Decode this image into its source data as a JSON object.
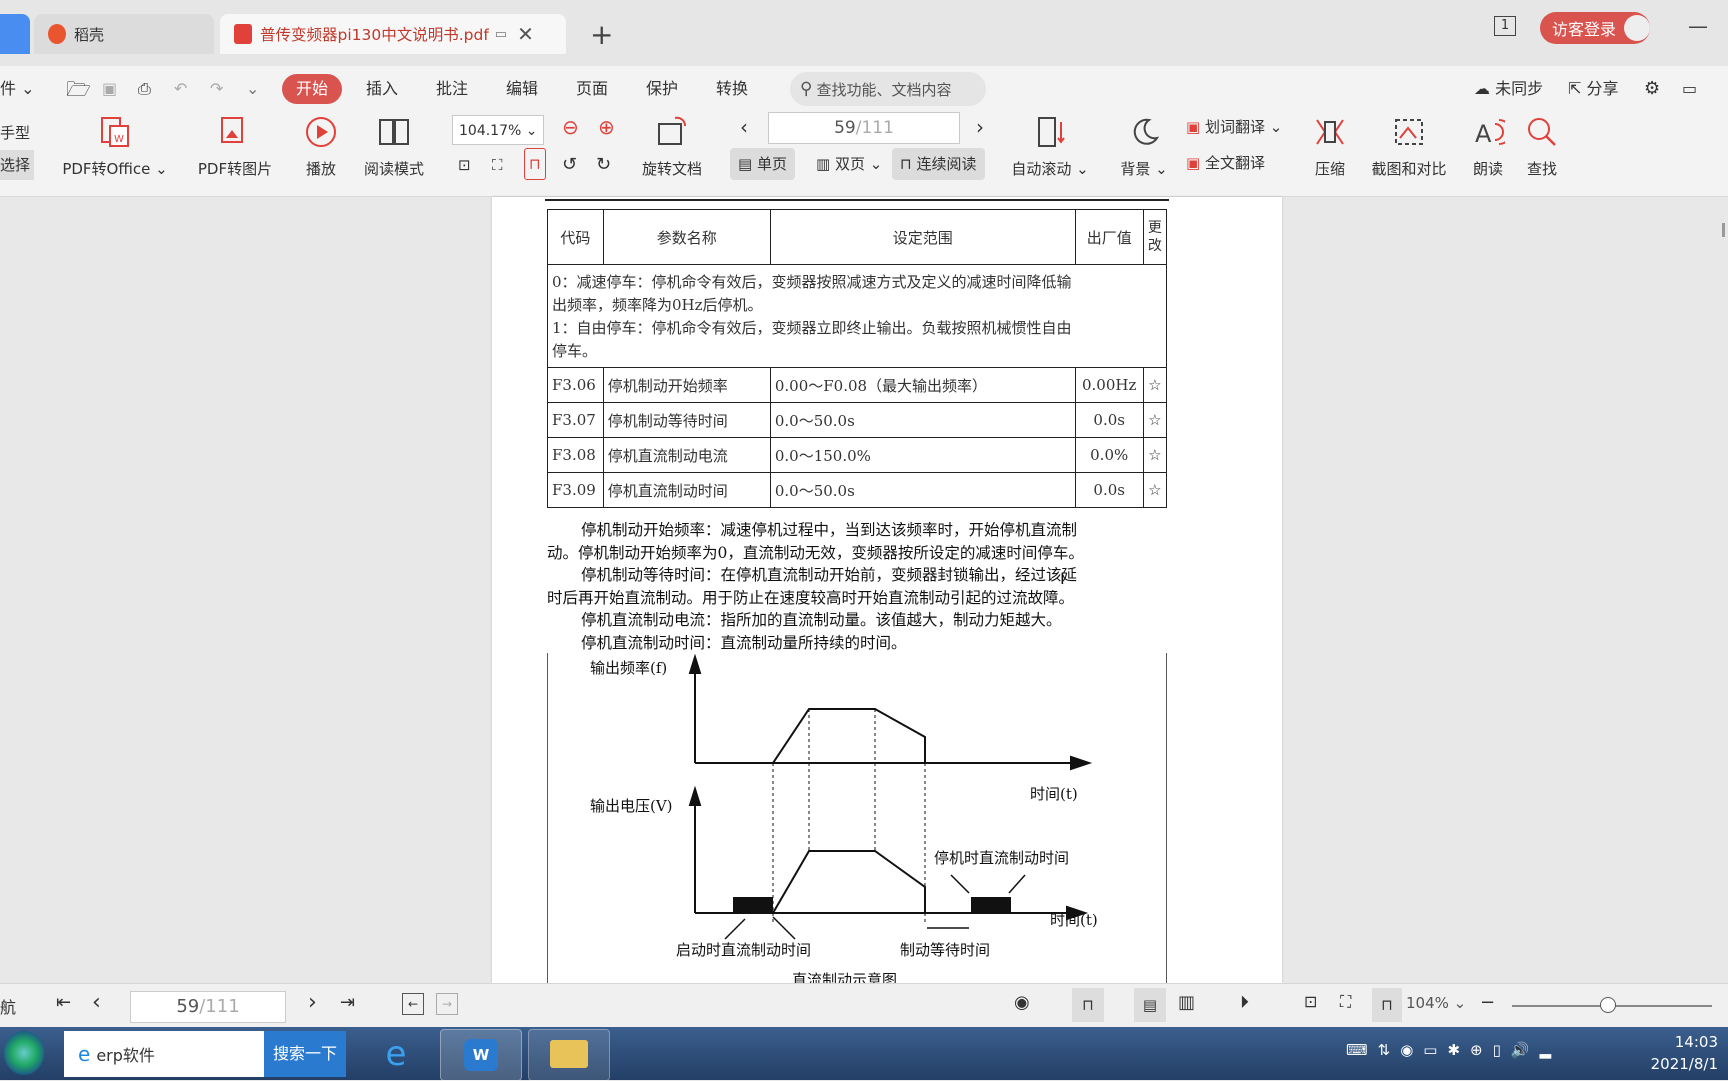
{
  "tabs": {
    "home": "稻壳",
    "doc": "普传变频器pi130中文说明书.pdf"
  },
  "titlebar": {
    "page_indicator": "1",
    "login": "访客登录"
  },
  "menu": {
    "file": "件",
    "items": [
      "开始",
      "插入",
      "批注",
      "编辑",
      "页面",
      "保护",
      "转换"
    ],
    "search_placeholder": "查找功能、文档内容",
    "sync": "未同步",
    "share": "分享"
  },
  "toolbar": {
    "left_cut1": "手型",
    "left_cut2": "选择",
    "pdf_to_office": "PDF转Office",
    "pdf_to_image": "PDF转图片",
    "play": "播放",
    "read_mode": "阅读模式",
    "zoom": "104.17%",
    "rotate": "旋转文档",
    "page_current": "59",
    "page_total": "/111",
    "single": "单页",
    "double": "双页",
    "continuous": "连续阅读",
    "auto_scroll": "自动滚动",
    "background": "背景",
    "word_translate": "划词翻译",
    "full_translate": "全文翻译",
    "compress": "压缩",
    "screenshot_compare": "截图和对比",
    "read_aloud": "朗读",
    "find": "查找"
  },
  "document": {
    "table_headers": [
      "代码",
      "参数名称",
      "设定范围",
      "出厂值",
      "更改"
    ],
    "intro_lines": [
      "0：减速停车：停机命令有效后，变频器按照减速方式及定义的减速时间降低输",
      "出频率，频率降为0Hz后停机。",
      "1：自由停车：停机命令有效后，变频器立即终止输出。负载按照机械惯性自由",
      "停车。"
    ],
    "rows": [
      {
        "code": "F3.06",
        "name": "停机制动开始频率",
        "range": "0.00～F0.08（最大输出频率）",
        "default": "0.00Hz",
        "change": "☆"
      },
      {
        "code": "F3.07",
        "name": "停机制动等待时间",
        "range": "0.0～50.0s",
        "default": "0.0s",
        "change": "☆"
      },
      {
        "code": "F3.08",
        "name": "停机直流制动电流",
        "range": "0.0～150.0%",
        "default": "0.0%",
        "change": "☆"
      },
      {
        "code": "F3.09",
        "name": "停机直流制动时间",
        "range": "0.0～50.0s",
        "default": "0.0s",
        "change": "☆"
      }
    ],
    "desc_lines": [
      "停机制动开始频率：减速停机过程中，当到达该频率时，开始停机直流制",
      "动。停机制动开始频率为0，直流制动无效，变频器按所设定的减速时间停车。",
      "停机制动等待时间：在停机直流制动开始前，变频器封锁输出，经过该延",
      "时后再开始直流制动。用于防止在速度较高时开始直流制动引起的过流故障。",
      "停机直流制动电流：指所加的直流制动量。该值越大，制动力矩越大。",
      "停机直流制动时间：直流制动量所持续的时间。"
    ],
    "diagram": {
      "freq_axis": "输出频率(f)",
      "volt_axis": "输出电压(V)",
      "time1": "时间(t)",
      "time2": "时间(t)",
      "stop_dc_time": "停机时直流制动时间",
      "start_dc_time": "启动时直流制动时间",
      "brake_wait": "制动等待时间",
      "caption": "直流制动示意图"
    }
  },
  "statusbar": {
    "nav": "航",
    "page_current": "59",
    "page_total": "/111",
    "zoom": "104%"
  },
  "taskbar": {
    "search_text": "erp软件",
    "search_button": "搜索一下",
    "time": "14:03",
    "date": "2021/8/1"
  },
  "colors": {
    "accent": "#d9534f",
    "taskbar": "#2d4b76"
  }
}
